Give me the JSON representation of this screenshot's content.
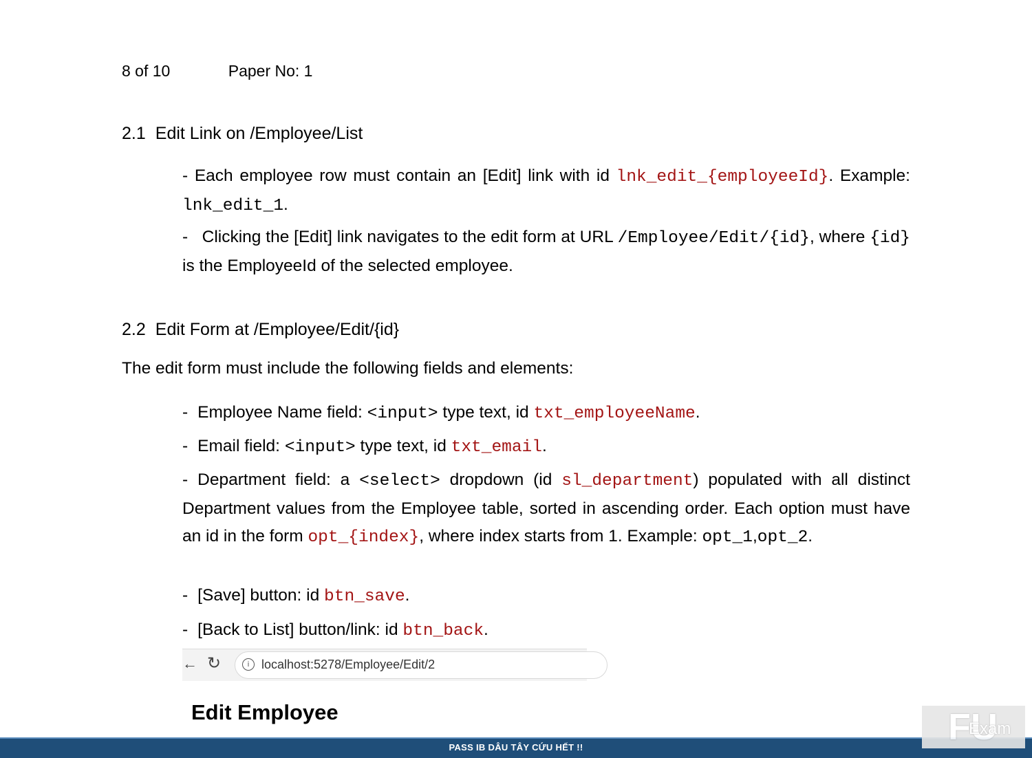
{
  "header": {
    "page": "8 of 10",
    "paper": "Paper No: 1"
  },
  "section_2_1": {
    "number": "2.1",
    "title": "Edit Link on /Employee/List",
    "p1_a": "Each employee row must contain an [Edit] link with id ",
    "p1_code": "lnk_edit_{employeeId}",
    "p1_b": ". Example: ",
    "p1_example": "lnk_edit_1",
    "p1_c": ".",
    "p2_a": "Clicking the [Edit] link navigates to the edit form at URL ",
    "p2_code": "/Employee/Edit/{id}",
    "p2_b": ", where ",
    "p2_code2": "{id}",
    "p2_c": " is the EmployeeId of the selected employee."
  },
  "section_2_2": {
    "number": "2.2",
    "title": "Edit Form at /Employee/Edit/{id}",
    "intro": "The edit form must include the following fields and elements:",
    "b1_a": "Employee Name field: ",
    "b1_tag": "<input>",
    "b1_b": " type text, id ",
    "b1_id": "txt_employeeName",
    "b2_a": "Email field: ",
    "b2_tag": "<input>",
    "b2_b": " type text, id ",
    "b2_id": "txt_email",
    "b3_a": "Department field: a ",
    "b3_tag": "<select>",
    "b3_b": " dropdown (id ",
    "b3_id": "sl_department",
    "b3_c": ") populated with all distinct Department values from the Employee table, sorted in ascending order. Each option must have an id in the form ",
    "b3_code": "opt_{index}",
    "b3_d": ", where index starts from 1. Example: ",
    "b3_ex1": "opt_1",
    "b3_ex2": "opt_2",
    "b4_a": "[Save] button: id ",
    "b4_id": "btn_save",
    "b5_a": "[Back to List] button/link: id ",
    "b5_id": "btn_back"
  },
  "browser": {
    "url": "localhost:5278/Employee/Edit/2"
  },
  "screenshot_heading": "Edit Employee",
  "footer": {
    "text": "PASS IB DÂU TÂY CỨU HẾT !!"
  },
  "logo": {
    "fu": "FU",
    "exam": "Exam"
  }
}
